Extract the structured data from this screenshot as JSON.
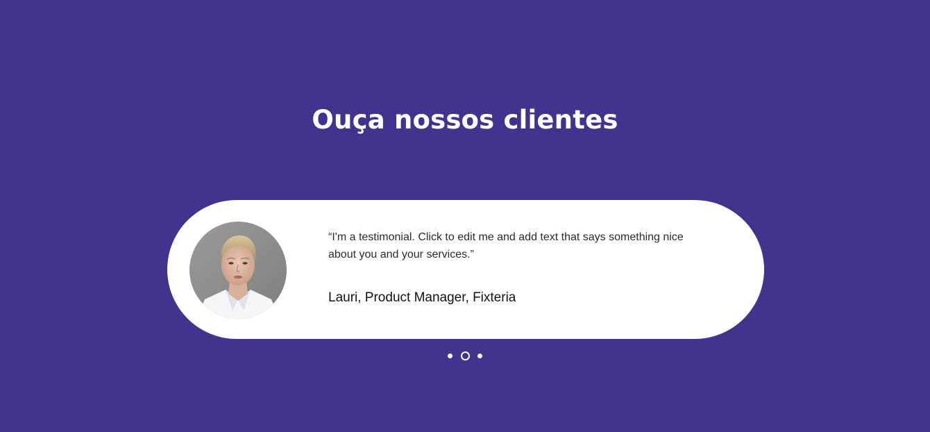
{
  "section": {
    "title": "Ouça nossos clientes",
    "background_color": "#42338e"
  },
  "testimonial": {
    "quote": "“I'm a testimonial. Click to edit me and add text that says something nice about you and your services.”",
    "author": "Lauri, Product Manager, Fixteria",
    "avatar_alt": "Lauri"
  },
  "slider": {
    "total_slides": 3,
    "active_index": 1
  }
}
